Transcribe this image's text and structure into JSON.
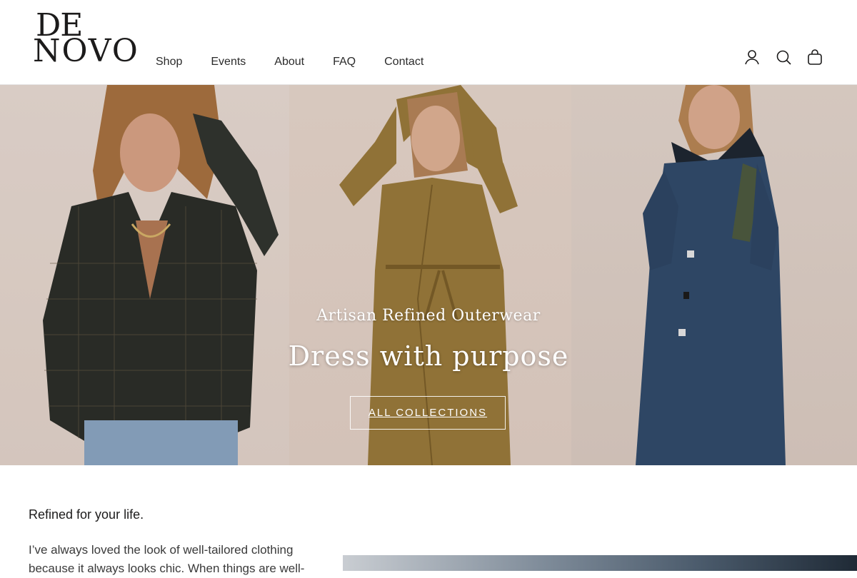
{
  "brand": {
    "line1": "DE",
    "line2": "NOVO"
  },
  "nav": {
    "items": [
      {
        "label": "Shop"
      },
      {
        "label": "Events"
      },
      {
        "label": "About"
      },
      {
        "label": "FAQ"
      },
      {
        "label": "Contact"
      }
    ]
  },
  "header_icons": [
    "account-icon",
    "search-icon",
    "cart-icon"
  ],
  "hero": {
    "subtitle": "Artisan Refined Outerwear",
    "title": "Dress with purpose",
    "button_label": "ALL COLLECTIONS"
  },
  "intro": {
    "title": "Refined for your life.",
    "body": "I’ve always loved the look of well-tailored clothing because it always looks chic. When things are well-"
  },
  "colors": {
    "coat_tan": "#9a7a3a",
    "coat_navy": "#2f4a6b",
    "blazer_green": "#2a2d28"
  }
}
